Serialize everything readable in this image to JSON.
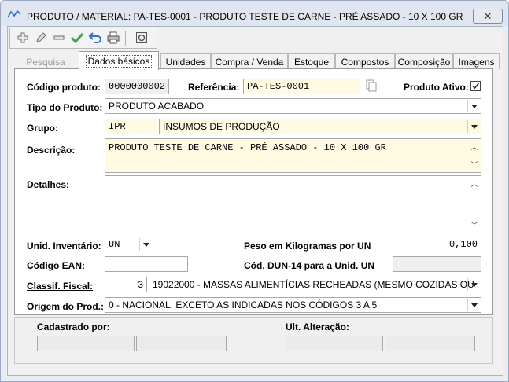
{
  "window": {
    "title": "PRODUTO / MATERIAL: PA-TES-0001 - PRODUTO TESTE DE CARNE - PRÉ ASSADO - 10 X 100 GR",
    "close_glyph": "✕"
  },
  "toolbar": {
    "buttons": [
      {
        "name": "add-icon",
        "color": "#7a7a7a"
      },
      {
        "name": "edit-pencil-icon",
        "color": "#7a7a7a"
      },
      {
        "name": "remove-minus-icon",
        "color": "#7a7a7a"
      },
      {
        "name": "confirm-check-icon",
        "color": "#3aa640"
      },
      {
        "name": "undo-icon",
        "color": "#3a6fc4"
      },
      {
        "name": "print-icon",
        "color": "#555555"
      },
      {
        "name": "exit-icon",
        "color": "#555555"
      }
    ]
  },
  "tabs": [
    {
      "label": "Pesquisa",
      "state": "disabled"
    },
    {
      "label": "Dados básicos",
      "state": "active"
    },
    {
      "label": "Unidades",
      "state": "normal"
    },
    {
      "label": "Compra / Venda",
      "state": "normal"
    },
    {
      "label": "Estoque",
      "state": "normal"
    },
    {
      "label": "Compostos",
      "state": "normal"
    },
    {
      "label": "Composição",
      "state": "normal"
    },
    {
      "label": "Imagens",
      "state": "normal"
    }
  ],
  "form": {
    "codigo_label": "Código produto:",
    "codigo_value": "0000000002",
    "referencia_label": "Referência:",
    "referencia_value": "PA-TES-0001",
    "ativo_label": "Produto Ativo:",
    "ativo_checked": true,
    "tipo_label": "Tipo do Produto:",
    "tipo_value": "PRODUTO ACABADO",
    "grupo_label": "Grupo:",
    "grupo_code": "IPR",
    "grupo_value": "INSUMOS DE PRODUÇÃO",
    "descricao_label": "Descrição:",
    "descricao_value": "PRODUTO TESTE DE CARNE - PRÉ ASSADO - 10 X 100 GR",
    "detalhes_label": "Detalhes:",
    "detalhes_value": "",
    "unid_label": "Unid. Inventário:",
    "unid_value": "UN",
    "peso_label": "Peso em Kilogramas por  UN",
    "peso_value": "0,100",
    "ean_label": "Código EAN:",
    "ean_value": "",
    "dun_label": "Cód. DUN-14 para a Unid.  UN",
    "dun_value": "",
    "classif_label": "Classif. Fiscal:",
    "classif_num": "3",
    "classif_value": "19022000 - MASSAS ALIMENTÍCIAS RECHEADAS (MESMO COZIDAS OU",
    "origem_label": "Origem do Prod.:",
    "origem_value": "0 - NACIONAL, EXCETO AS INDICADAS NOS CÓDIGOS 3 A 5"
  },
  "footer": {
    "cadastrado_label": "Cadastrado por:",
    "alteracao_label": "Ult. Alteração:"
  }
}
